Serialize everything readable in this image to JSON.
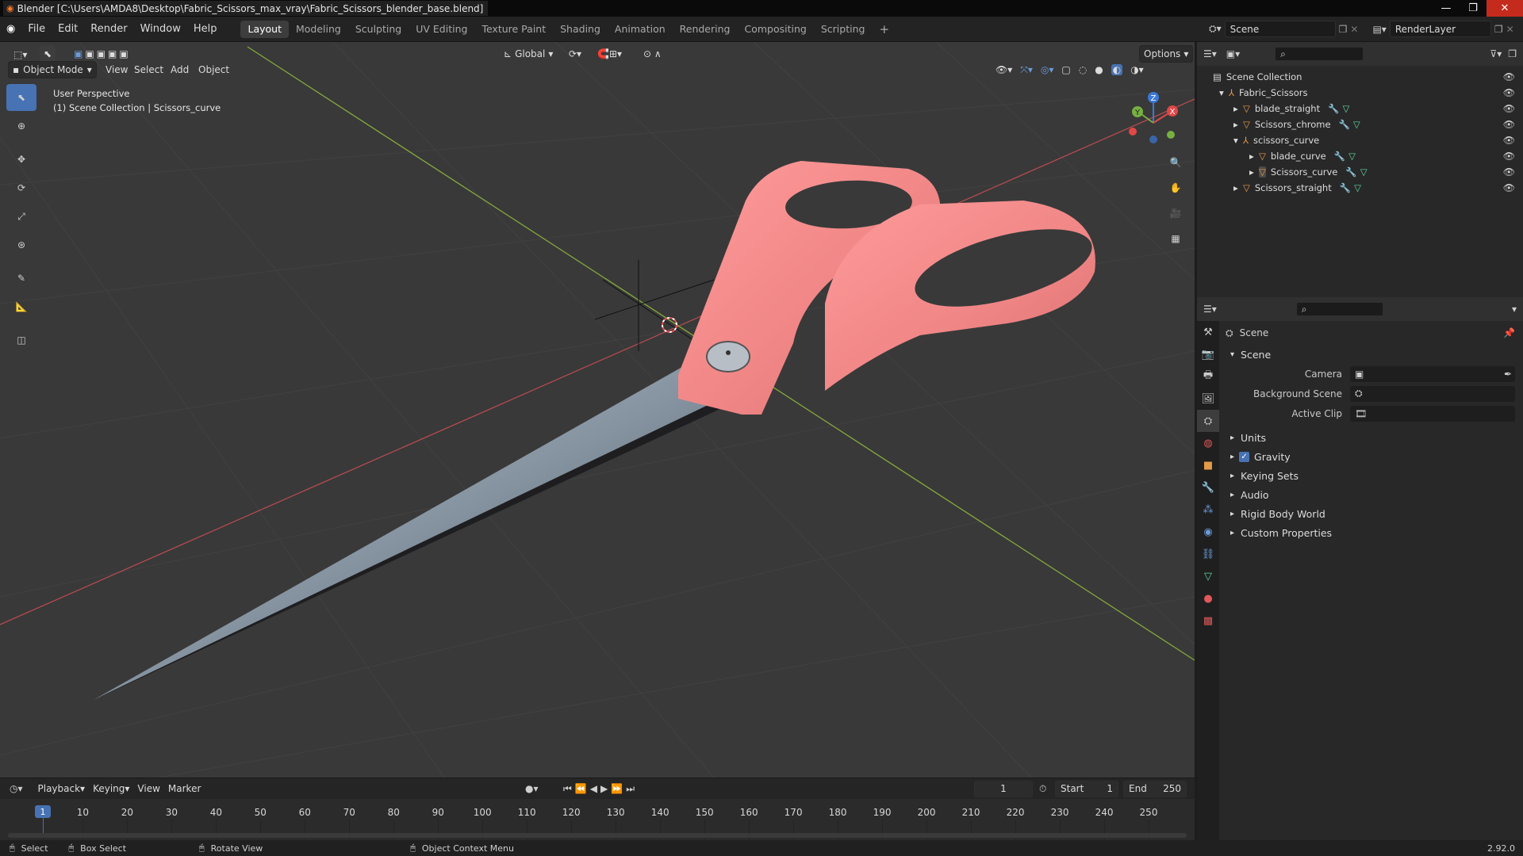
{
  "titlebar": {
    "title": "Blender [C:\\Users\\AMDA8\\Desktop\\Fabric_Scissors_max_vray\\Fabric_Scissors_blender_base.blend]"
  },
  "menu": {
    "items": [
      "File",
      "Edit",
      "Render",
      "Window",
      "Help"
    ]
  },
  "workspaces": [
    "Layout",
    "Modeling",
    "Sculpting",
    "UV Editing",
    "Texture Paint",
    "Shading",
    "Animation",
    "Rendering",
    "Compositing",
    "Scripting"
  ],
  "scene_selector": {
    "scene": "Scene",
    "view_layer": "RenderLayer"
  },
  "viewport": {
    "transform_orientation": "Global",
    "options_label": "Options",
    "mode": "Object Mode",
    "header_menus": [
      "View",
      "Select",
      "Add",
      "Object"
    ],
    "overlay_line1": "User Perspective",
    "overlay_line2": "(1) Scene Collection | Scissors_curve",
    "gizmo": {
      "x": "X",
      "y": "Y",
      "z": "Z"
    }
  },
  "outliner": {
    "root": "Scene Collection",
    "items": [
      {
        "name": "Fabric_Scissors",
        "type": "empty",
        "depth": 1,
        "expanded": true
      },
      {
        "name": "blade_straight",
        "type": "mesh",
        "depth": 2
      },
      {
        "name": "Scissors_chrome",
        "type": "mesh",
        "depth": 2
      },
      {
        "name": "scissors_curve",
        "type": "empty",
        "depth": 2,
        "expanded": true
      },
      {
        "name": "blade_curve",
        "type": "mesh",
        "depth": 3
      },
      {
        "name": "Scissors_curve",
        "type": "mesh",
        "depth": 3,
        "active": true
      },
      {
        "name": "Scissors_straight",
        "type": "mesh",
        "depth": 2
      }
    ]
  },
  "properties": {
    "context": "Scene",
    "panel_title": "Scene",
    "fields": [
      {
        "label": "Camera",
        "value": ""
      },
      {
        "label": "Background Scene",
        "value": ""
      },
      {
        "label": "Active Clip",
        "value": ""
      }
    ],
    "subpanels": [
      {
        "label": "Units",
        "checkbox": false
      },
      {
        "label": "Gravity",
        "checkbox": true
      },
      {
        "label": "Keying Sets",
        "checkbox": false
      },
      {
        "label": "Audio",
        "checkbox": false
      },
      {
        "label": "Rigid Body World",
        "checkbox": false
      },
      {
        "label": "Custom Properties",
        "checkbox": false
      }
    ]
  },
  "timeline": {
    "menus": [
      "Playback",
      "Keying",
      "View",
      "Marker"
    ],
    "current_frame": "1",
    "start_label": "Start",
    "start": "1",
    "end_label": "End",
    "end": "250",
    "ticks": [
      "1",
      "10",
      "20",
      "30",
      "40",
      "50",
      "60",
      "70",
      "80",
      "90",
      "100",
      "110",
      "120",
      "130",
      "140",
      "150",
      "160",
      "170",
      "180",
      "190",
      "200",
      "210",
      "220",
      "230",
      "240",
      "250"
    ]
  },
  "statusbar": {
    "select": "Select",
    "box_select": "Box Select",
    "rotate_view": "Rotate View",
    "context_menu": "Object Context Menu",
    "version": "2.92.0"
  },
  "colors": {
    "accent": "#4772b3",
    "handle": "#f08c8c",
    "blade": "#9aa7b3",
    "x_axis": "#b34b50",
    "y_axis": "#86a93c"
  }
}
